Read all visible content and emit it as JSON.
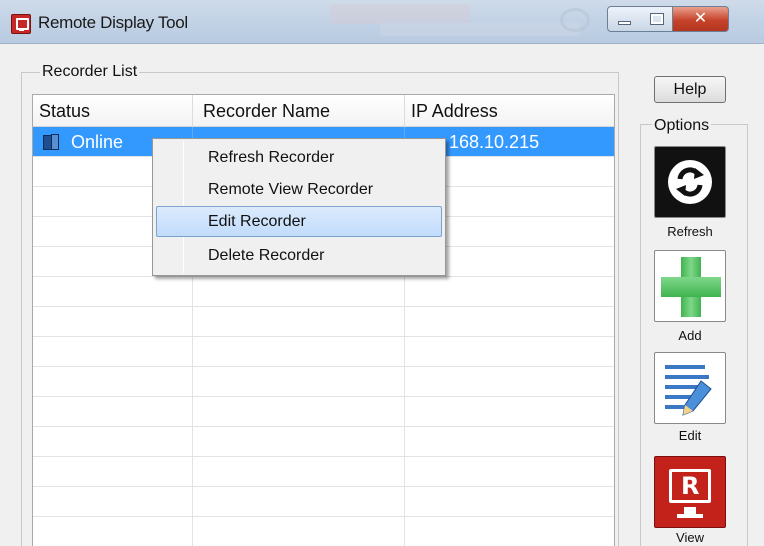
{
  "window": {
    "title": "Remote Display Tool"
  },
  "recorder_list": {
    "group_label": "Recorder List",
    "columns": [
      "Status",
      "Recorder Name",
      "IP Address"
    ],
    "rows": [
      {
        "status": "Online",
        "name": "",
        "ip": "168.10.215",
        "selected": true
      }
    ]
  },
  "context_menu": {
    "items": [
      {
        "label": "Refresh Recorder"
      },
      {
        "label": "Remote View Recorder"
      },
      {
        "label": "Edit Recorder",
        "highlighted": true
      },
      {
        "label": "Delete Recorder"
      }
    ]
  },
  "sidebar": {
    "help_label": "Help",
    "options_label": "Options",
    "buttons": [
      {
        "label": "Refresh",
        "icon": "refresh-icon"
      },
      {
        "label": "Add",
        "icon": "plus-icon"
      },
      {
        "label": "Edit",
        "icon": "edit-document-icon"
      },
      {
        "label": "View",
        "icon": "remote-view-icon"
      }
    ]
  },
  "colors": {
    "selection": "#3399ff",
    "menu_highlight": "#c1dbfc",
    "close_button": "#c7432a",
    "add_green": "#3fb34f",
    "view_red": "#c22219"
  }
}
